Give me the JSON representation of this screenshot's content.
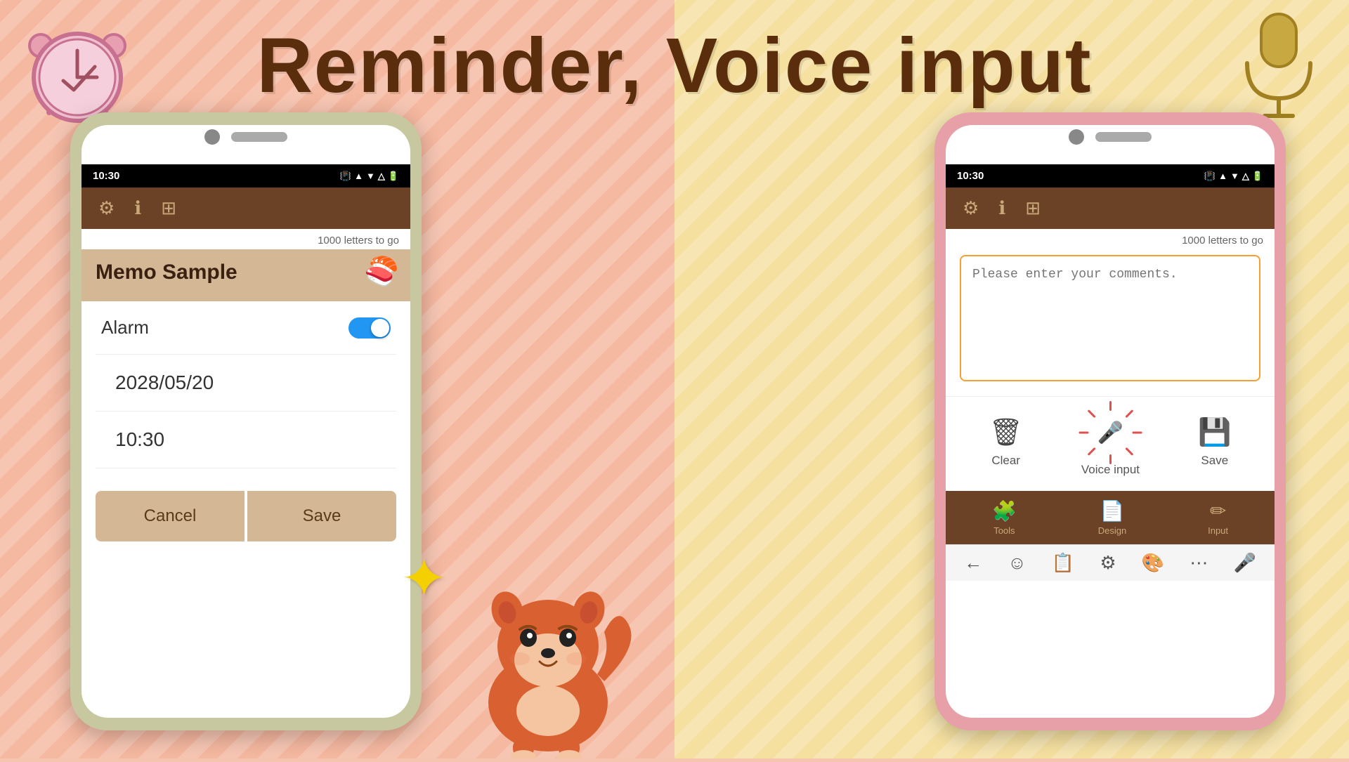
{
  "background": {
    "left_color": "#f5b0a0",
    "right_color": "#f5e0a0"
  },
  "title": "Reminder, Voice input",
  "left_phone": {
    "status_time": "10:30",
    "letter_count": "1000 letters to go",
    "memo_title": "Memo Sample",
    "alarm_label": "Alarm",
    "date_value": "2028/05/20",
    "time_value": "10:30",
    "cancel_label": "Cancel",
    "save_label": "Save",
    "toolbar_icons": [
      "⚙",
      "ℹ",
      "⊞"
    ]
  },
  "right_phone": {
    "status_time": "10:30",
    "letter_count": "1000 letters to go",
    "textarea_placeholder": "Please enter your comments.",
    "clear_label": "Clear",
    "voice_input_label": "Voice input",
    "save_label": "Save",
    "toolbar_icons": [
      "⚙",
      "ℹ",
      "⊞"
    ],
    "tabs": [
      {
        "label": "Tools",
        "icon": "puzzle"
      },
      {
        "label": "Design",
        "icon": "page"
      },
      {
        "label": "Input",
        "icon": "pencil"
      }
    ],
    "nav_icons": [
      "←",
      "☺",
      "📋",
      "⚙",
      "🎨",
      "⋯",
      "🎤"
    ]
  },
  "star_sparkle": "★",
  "icons": {
    "alarm_clock": "alarm-clock-icon",
    "microphone": "microphone-icon",
    "clear": "trash-icon",
    "voice": "voice-mic-icon",
    "save": "save-floppy-icon",
    "gear": "gear-icon",
    "info": "info-icon",
    "puzzle": "puzzle-icon"
  }
}
